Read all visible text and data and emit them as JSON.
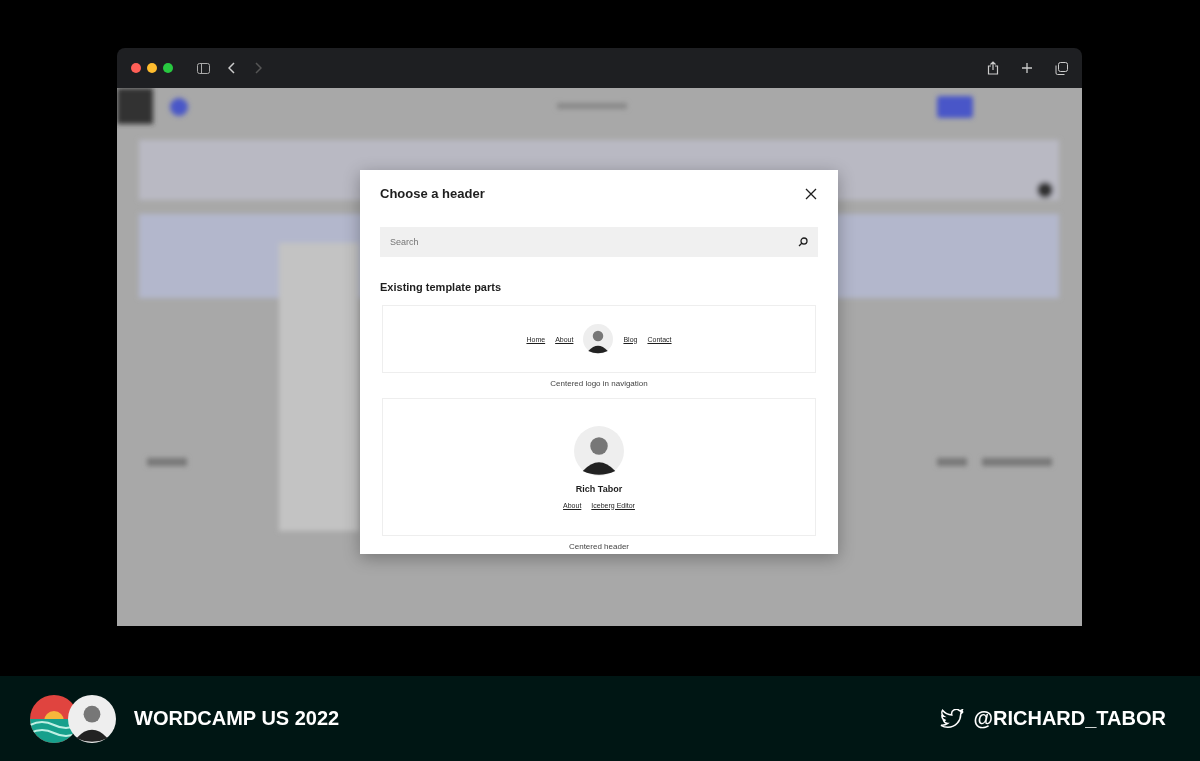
{
  "modal": {
    "title": "Choose a header",
    "search": {
      "placeholder": "Search"
    },
    "section_title": "Existing template parts",
    "parts": [
      {
        "kind": "inline",
        "links_left": [
          "Home",
          "About"
        ],
        "links_right": [
          "Blog",
          "Contact"
        ],
        "caption": "Centered logo in navigation"
      },
      {
        "kind": "stacked",
        "site_title": "Rich Tabor",
        "links_left": [
          "About",
          "Iceberg Editor"
        ],
        "caption": "Centered header"
      }
    ]
  },
  "footer": {
    "event": "WORDCAMP US 2022",
    "handle": "@RICHARD_TABOR"
  }
}
